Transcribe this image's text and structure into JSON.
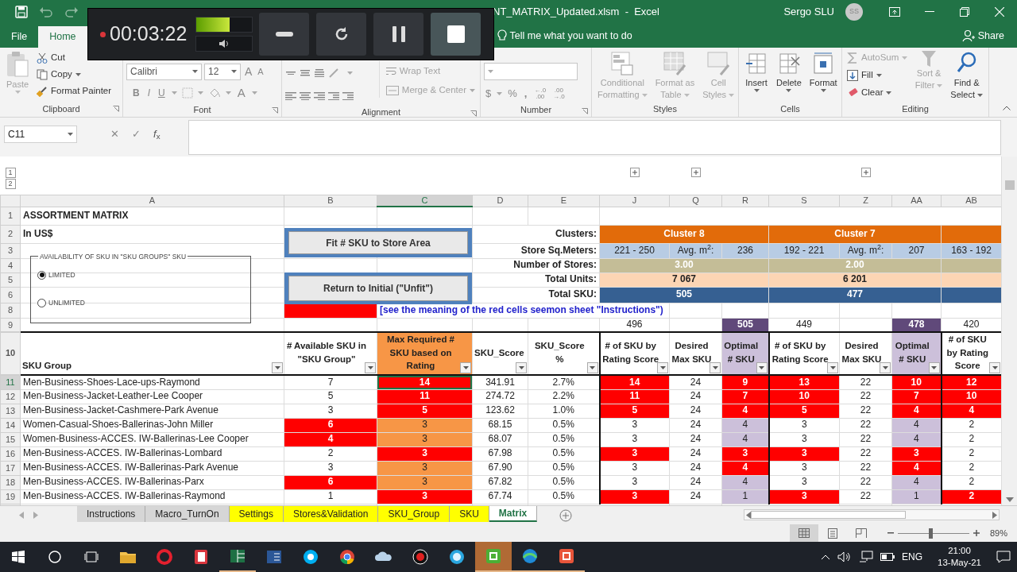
{
  "recorder": {
    "time": "00:03:22",
    "level": 0.6
  },
  "title_bar": {
    "title": "NT_MATRIX_Updated.xlsm  -  Excel",
    "user": "Sergo SLU",
    "initials": "SS"
  },
  "ribbon_tabs": [
    {
      "label": "File",
      "selected": false
    },
    {
      "label": "Home",
      "selected": true
    }
  ],
  "tell_me": "Tell me what you want to do",
  "share": "Share",
  "ribbon": {
    "clipboard": {
      "label": "Clipboard",
      "paste": "Paste",
      "items": [
        "Cut",
        "Copy",
        "Format Painter"
      ]
    },
    "font": {
      "label": "Font",
      "family": "Calibri",
      "size": "12",
      "size_buttons": [
        "A",
        "A"
      ],
      "styles": [
        "B",
        "I",
        "U"
      ],
      "color_button": "A"
    },
    "alignment": {
      "label": "Alignment",
      "wrap": "Wrap Text",
      "merge": "Merge & Center"
    },
    "number": {
      "label": "Number",
      "symbols": [
        "$",
        "%",
        ","
      ],
      "decimals": [
        [
          "←.0",
          ".00"
        ],
        [
          ".00",
          "→.0"
        ]
      ]
    },
    "styles": {
      "label": "Styles",
      "buttons": [
        {
          "lines": [
            "Conditional",
            "Formatting"
          ],
          "disabled": true
        },
        {
          "lines": [
            "Format as",
            "Table"
          ],
          "disabled": true
        },
        {
          "lines": [
            "Cell",
            "Styles"
          ],
          "disabled": true
        }
      ]
    },
    "cells": {
      "label": "Cells",
      "buttons": [
        "Insert",
        "Delete",
        "Format"
      ]
    },
    "editing": {
      "label": "Editing",
      "items": [
        {
          "label": "AutoSum",
          "disabled": true
        },
        {
          "label": "Fill",
          "disabled": false
        },
        {
          "label": "Clear",
          "disabled": false
        }
      ],
      "buttons": [
        {
          "lines": [
            "Sort &",
            "Filter"
          ],
          "disabled": true
        },
        {
          "lines": [
            "Find &",
            "Select"
          ],
          "disabled": false
        }
      ]
    }
  },
  "formula_bar": {
    "name_box": "C11",
    "cancel": "✕",
    "enter": "✓",
    "fx": "*f*$_{x}$"
  },
  "sheet": {
    "outline_levels": [
      "1",
      "2"
    ],
    "columns": [
      {
        "label": "A",
        "selected": false
      },
      {
        "label": "B",
        "selected": false
      },
      {
        "label": "C",
        "selected": true
      },
      {
        "label": "D",
        "selected": false
      },
      {
        "label": "E",
        "selected": false
      },
      {
        "label": "J",
        "selected": false
      },
      {
        "label": "Q",
        "selected": false
      },
      {
        "label": "R",
        "selected": false
      },
      {
        "label": "S",
        "selected": false
      },
      {
        "label": "Z",
        "selected": false
      },
      {
        "label": "AA",
        "selected": false
      },
      {
        "label": "AB",
        "selected": false
      }
    ],
    "row_numbers": [
      "1",
      "2",
      "3",
      "4",
      "5",
      "6",
      "8",
      "9",
      "10"
    ],
    "title": "ASSORTMENT MATRIX",
    "subtitle": "In US$",
    "option_group": {
      "legend": "AVAILABILITY OF SKU IN \"SKU GROUPS\" SKU",
      "options": [
        {
          "label": "LIMITED",
          "selected": true
        },
        {
          "label": "UNLIMITED",
          "selected": false
        }
      ]
    },
    "macro_buttons": [
      "Fit # SKU to Store Area",
      "Return to Initial (\"Unfit\")"
    ],
    "summary_labels": [
      "Clusters:",
      "Store Sq.Meters:",
      "Number of Stores:",
      "Total Units:",
      "Total SKU:"
    ],
    "clusters": [
      {
        "name": "Cluster 8",
        "range": "221 - 250",
        "avg_label": "Avg. m$^{2}$:",
        "avg": "236",
        "stores": "3.00",
        "units": "7 067",
        "sku": "505"
      },
      {
        "name": "Cluster 7",
        "range": "192 - 221",
        "avg_label": "Avg. m$^{2}$:",
        "avg": "207",
        "stores": "2.00",
        "units": "6 201",
        "sku": "477"
      },
      {
        "range": "163 - 192"
      }
    ],
    "note": "[see the meaning of the red cells seemon sheet \"Instructions\")",
    "totals": [
      {
        "text": "496",
        "kind": "count"
      },
      {
        "text": "505",
        "kind": "optimal"
      },
      {
        "text": "449",
        "kind": "count"
      },
      {
        "text": "478",
        "kind": "optimal"
      },
      {
        "text": "420",
        "kind": "count"
      }
    ],
    "headers": [
      {
        "text": "SKU Group",
        "kind": "name"
      },
      {
        "text": "# Available SKU in \"SKU Group\"",
        "kind": "plain"
      },
      {
        "text": "Max Required # SKU based on Rating",
        "kind": "required"
      },
      {
        "text": "SKU_Score",
        "kind": "plain"
      },
      {
        "text": "SKU_Score %",
        "kind": "plain"
      },
      {
        "text": "# of SKU by Rating Score",
        "kind": "plain"
      },
      {
        "text": "Desired Max SKU",
        "kind": "plain"
      },
      {
        "text": "Optimal # SKU",
        "kind": "optimal"
      },
      {
        "text": "# of SKU by Rating Score",
        "kind": "plain"
      },
      {
        "text": "Desired Max SKU",
        "kind": "plain"
      },
      {
        "text": "Optimal # SKU",
        "kind": "optimal"
      },
      {
        "text": "# of SKU by Rating Score",
        "kind": "plain"
      }
    ],
    "rows": [
      {
        "number": "11",
        "selected": true,
        "cells": [
          {
            "text": "Men-Business-Shoes-Lace-ups-Raymond",
            "flagged": false
          },
          {
            "text": "7",
            "flagged": false
          },
          {
            "text": "14",
            "flagged": true
          },
          {
            "text": "341.91",
            "flagged": false
          },
          {
            "text": "2.7%",
            "flagged": false
          },
          {
            "text": "14",
            "flagged": true
          },
          {
            "text": "24",
            "flagged": false
          },
          {
            "text": "9",
            "flagged": true
          },
          {
            "text": "13",
            "flagged": true
          },
          {
            "text": "22",
            "flagged": false
          },
          {
            "text": "10",
            "flagged": true
          },
          {
            "text": "12",
            "flagged": true
          }
        ]
      },
      {
        "number": "12",
        "selected": false,
        "cells": [
          {
            "text": "Men-Business-Jacket-Leather-Lee Cooper",
            "flagged": false
          },
          {
            "text": "5",
            "flagged": false
          },
          {
            "text": "11",
            "flagged": true
          },
          {
            "text": "274.72",
            "flagged": false
          },
          {
            "text": "2.2%",
            "flagged": false
          },
          {
            "text": "11",
            "flagged": true
          },
          {
            "text": "24",
            "flagged": false
          },
          {
            "text": "7",
            "flagged": true
          },
          {
            "text": "10",
            "flagged": true
          },
          {
            "text": "22",
            "flagged": false
          },
          {
            "text": "7",
            "flagged": true
          },
          {
            "text": "10",
            "flagged": true
          }
        ]
      },
      {
        "number": "13",
        "selected": false,
        "cells": [
          {
            "text": "Men-Business-Jacket-Cashmere-Park Avenue",
            "flagged": false
          },
          {
            "text": "3",
            "flagged": false
          },
          {
            "text": "5",
            "flagged": true
          },
          {
            "text": "123.62",
            "flagged": false
          },
          {
            "text": "1.0%",
            "flagged": false
          },
          {
            "text": "5",
            "flagged": true
          },
          {
            "text": "24",
            "flagged": false
          },
          {
            "text": "4",
            "flagged": true
          },
          {
            "text": "5",
            "flagged": true
          },
          {
            "text": "22",
            "flagged": false
          },
          {
            "text": "4",
            "flagged": true
          },
          {
            "text": "4",
            "flagged": true
          }
        ]
      },
      {
        "number": "14",
        "selected": false,
        "cells": [
          {
            "text": "Women-Casual-Shoes-Ballerinas-John Miller",
            "flagged": false
          },
          {
            "text": "6",
            "flagged": true
          },
          {
            "text": "3",
            "flagged": false
          },
          {
            "text": "68.15",
            "flagged": false
          },
          {
            "text": "0.5%",
            "flagged": false
          },
          {
            "text": "3",
            "flagged": false
          },
          {
            "text": "24",
            "flagged": false
          },
          {
            "text": "4",
            "flagged": false
          },
          {
            "text": "3",
            "flagged": false
          },
          {
            "text": "22",
            "flagged": false
          },
          {
            "text": "4",
            "flagged": false
          },
          {
            "text": "2",
            "flagged": false
          }
        ]
      },
      {
        "number": "15",
        "selected": false,
        "cells": [
          {
            "text": "Women-Business-ACCES. IW-Ballerinas-Lee Cooper",
            "flagged": false
          },
          {
            "text": "4",
            "flagged": true
          },
          {
            "text": "3",
            "flagged": false
          },
          {
            "text": "68.07",
            "flagged": false
          },
          {
            "text": "0.5%",
            "flagged": false
          },
          {
            "text": "3",
            "flagged": false
          },
          {
            "text": "24",
            "flagged": false
          },
          {
            "text": "4",
            "flagged": false
          },
          {
            "text": "3",
            "flagged": false
          },
          {
            "text": "22",
            "flagged": false
          },
          {
            "text": "4",
            "flagged": false
          },
          {
            "text": "2",
            "flagged": false
          }
        ]
      },
      {
        "number": "16",
        "selected": false,
        "cells": [
          {
            "text": "Men-Business-ACCES. IW-Ballerinas-Lombard",
            "flagged": false
          },
          {
            "text": "2",
            "flagged": false
          },
          {
            "text": "3",
            "flagged": true
          },
          {
            "text": "67.98",
            "flagged": false
          },
          {
            "text": "0.5%",
            "flagged": false
          },
          {
            "text": "3",
            "flagged": true
          },
          {
            "text": "24",
            "flagged": false
          },
          {
            "text": "3",
            "flagged": true
          },
          {
            "text": "3",
            "flagged": true
          },
          {
            "text": "22",
            "flagged": false
          },
          {
            "text": "3",
            "flagged": true
          },
          {
            "text": "2",
            "flagged": false
          }
        ]
      },
      {
        "number": "17",
        "selected": false,
        "cells": [
          {
            "text": "Men-Business-ACCES. IW-Ballerinas-Park Avenue",
            "flagged": false
          },
          {
            "text": "3",
            "flagged": false
          },
          {
            "text": "3",
            "flagged": false
          },
          {
            "text": "67.90",
            "flagged": false
          },
          {
            "text": "0.5%",
            "flagged": false
          },
          {
            "text": "3",
            "flagged": false
          },
          {
            "text": "24",
            "flagged": false
          },
          {
            "text": "4",
            "flagged": true
          },
          {
            "text": "3",
            "flagged": false
          },
          {
            "text": "22",
            "flagged": false
          },
          {
            "text": "4",
            "flagged": true
          },
          {
            "text": "2",
            "flagged": false
          }
        ]
      },
      {
        "number": "18",
        "selected": false,
        "cells": [
          {
            "text": "Men-Business-ACCES. IW-Ballerinas-Parx",
            "flagged": false
          },
          {
            "text": "6",
            "flagged": true
          },
          {
            "text": "3",
            "flagged": false
          },
          {
            "text": "67.82",
            "flagged": false
          },
          {
            "text": "0.5%",
            "flagged": false
          },
          {
            "text": "3",
            "flagged": false
          },
          {
            "text": "24",
            "flagged": false
          },
          {
            "text": "4",
            "flagged": false
          },
          {
            "text": "3",
            "flagged": false
          },
          {
            "text": "22",
            "flagged": false
          },
          {
            "text": "4",
            "flagged": false
          },
          {
            "text": "2",
            "flagged": false
          }
        ]
      },
      {
        "number": "19",
        "selected": false,
        "cells": [
          {
            "text": "Men-Business-ACCES. IW-Ballerinas-Raymond",
            "flagged": false
          },
          {
            "text": "1",
            "flagged": false
          },
          {
            "text": "3",
            "flagged": true
          },
          {
            "text": "67.74",
            "flagged": false
          },
          {
            "text": "0.5%",
            "flagged": false
          },
          {
            "text": "3",
            "flagged": true
          },
          {
            "text": "24",
            "flagged": false
          },
          {
            "text": "1",
            "flagged": false
          },
          {
            "text": "3",
            "flagged": true
          },
          {
            "text": "22",
            "flagged": false
          },
          {
            "text": "1",
            "flagged": false
          },
          {
            "text": "2",
            "flagged": true
          }
        ]
      }
    ]
  },
  "sheet_tabs": [
    {
      "label": "Instructions",
      "selected": false
    },
    {
      "label": "Macro_TurnOn",
      "selected": false
    },
    {
      "label": "Settings",
      "selected": false,
      "color": "#ffff00"
    },
    {
      "label": "Stores&Validation",
      "selected": false,
      "color": "#ffff00"
    },
    {
      "label": "SKU_Group",
      "selected": false,
      "color": "#ffff00"
    },
    {
      "label": "SKU",
      "selected": false,
      "color": "#ffff00"
    },
    {
      "label": "Matrix",
      "selected": true
    }
  ],
  "status_bar": {
    "zoom": {
      "level": 0.45,
      "reading": "89%"
    }
  },
  "taskbar": {
    "apps": [
      {
        "kind": "folder",
        "running": false,
        "selected": false
      },
      {
        "kind": "ring",
        "running": false,
        "selected": false
      },
      {
        "kind": "notebook",
        "running": false,
        "selected": false
      },
      {
        "kind": "spreadsheet",
        "running": true,
        "selected": false
      },
      {
        "kind": "document",
        "running": false,
        "selected": false
      },
      {
        "kind": "chat",
        "running": false,
        "selected": false
      },
      {
        "kind": "browser",
        "running": false,
        "selected": false
      },
      {
        "kind": "cloud",
        "running": false,
        "selected": false
      },
      {
        "kind": "record",
        "running": false,
        "selected": false
      },
      {
        "kind": "target",
        "running": false,
        "selected": false
      },
      {
        "kind": "tile",
        "running": true,
        "selected": true
      },
      {
        "kind": "wave",
        "running": true,
        "selected": false
      },
      {
        "kind": "tile2",
        "running": true,
        "selected": false
      }
    ],
    "language": "ENG",
    "time": "21:00",
    "date": "13-May-21"
  }
}
